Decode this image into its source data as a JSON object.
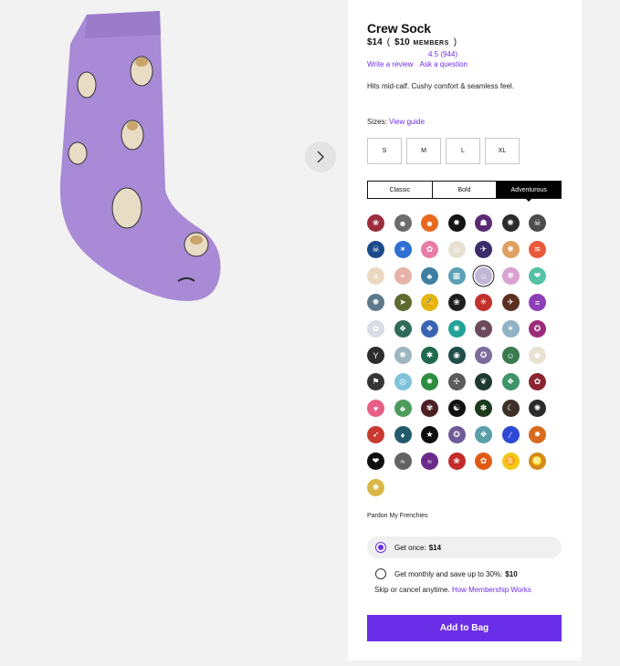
{
  "product": {
    "title": "Crew Sock",
    "price": "$14",
    "paren_open": "(",
    "member_price": "$10",
    "members_label": "MEMBERS",
    "paren_close": ")",
    "rating": "4.5",
    "review_count": "(944)",
    "write_review": "Write a review",
    "ask_question": "Ask a question",
    "description": "Hits mid-calf. Cushy comfort & seamless feel."
  },
  "sizes": {
    "label": "Sizes:",
    "guide_link": "View guide",
    "options": [
      "S",
      "M",
      "L",
      "XL"
    ]
  },
  "style_tabs": [
    "Classic",
    "Bold",
    "Adventurous"
  ],
  "active_style": "Adventurous",
  "swatches": [
    {
      "name": "swatch-1",
      "color": "#9b2d3c",
      "glyph": "❀"
    },
    {
      "name": "swatch-2",
      "color": "#6c6c6c",
      "glyph": "☻"
    },
    {
      "name": "swatch-3",
      "color": "#e8681f",
      "glyph": "☻"
    },
    {
      "name": "swatch-4",
      "color": "#151515",
      "glyph": "✹"
    },
    {
      "name": "swatch-5",
      "color": "#5a2b72",
      "glyph": "☗"
    },
    {
      "name": "swatch-6",
      "color": "#2a2a2a",
      "glyph": "✺"
    },
    {
      "name": "swatch-7",
      "color": "#4c4c4c",
      "glyph": "☠"
    },
    {
      "name": "swatch-8",
      "color": "#1c4a8a",
      "glyph": "☠"
    },
    {
      "name": "swatch-9",
      "color": "#2d6fd2",
      "glyph": "✶"
    },
    {
      "name": "swatch-10",
      "color": "#e87da8",
      "glyph": "✿"
    },
    {
      "name": "swatch-11",
      "color": "#e8e1d3",
      "glyph": "☺"
    },
    {
      "name": "swatch-12",
      "color": "#3a2d6b",
      "glyph": "✈"
    },
    {
      "name": "swatch-13",
      "color": "#e0a05f",
      "glyph": "✺"
    },
    {
      "name": "swatch-14",
      "color": "#e8593b",
      "glyph": "≋"
    },
    {
      "name": "swatch-15",
      "color": "#e9d8c0",
      "glyph": "≡"
    },
    {
      "name": "swatch-16",
      "color": "#e6b3a8",
      "glyph": "◓"
    },
    {
      "name": "swatch-17",
      "color": "#3e7fa3",
      "glyph": "♣"
    },
    {
      "name": "swatch-18",
      "color": "#5ca0b6",
      "glyph": "▦"
    },
    {
      "name": "swatch-19",
      "color": "#bfb7d4",
      "glyph": "☺"
    },
    {
      "name": "swatch-20",
      "color": "#d9a0d0",
      "glyph": "✾"
    },
    {
      "name": "swatch-21",
      "color": "#55c2a6",
      "glyph": "❤"
    },
    {
      "name": "swatch-22",
      "color": "#5d7a8c",
      "glyph": "✺"
    },
    {
      "name": "swatch-23",
      "color": "#5e6b2e",
      "glyph": "➤"
    },
    {
      "name": "swatch-24",
      "color": "#e4b60c",
      "glyph": "✍"
    },
    {
      "name": "swatch-25",
      "color": "#1f1f1f",
      "glyph": "❀"
    },
    {
      "name": "swatch-26",
      "color": "#c0312e",
      "glyph": "✳"
    },
    {
      "name": "swatch-27",
      "color": "#5a2f1f",
      "glyph": "✈"
    },
    {
      "name": "swatch-28",
      "color": "#8c3fb6",
      "glyph": "≡"
    },
    {
      "name": "swatch-29",
      "color": "#d7dce6",
      "glyph": "✿"
    },
    {
      "name": "swatch-30",
      "color": "#2f6b58",
      "glyph": "❖"
    },
    {
      "name": "swatch-31",
      "color": "#3a64b3",
      "glyph": "❖"
    },
    {
      "name": "swatch-32",
      "color": "#22a39a",
      "glyph": "✺"
    },
    {
      "name": "swatch-33",
      "color": "#6b4a5a",
      "glyph": "⚭"
    },
    {
      "name": "swatch-34",
      "color": "#8fb3c4",
      "glyph": "✶"
    },
    {
      "name": "swatch-35",
      "color": "#9c2c7a",
      "glyph": "✪"
    },
    {
      "name": "swatch-36",
      "color": "#2d2d2d",
      "glyph": "Y"
    },
    {
      "name": "swatch-37",
      "color": "#9db6c0",
      "glyph": "✺"
    },
    {
      "name": "swatch-38",
      "color": "#1f6a4d",
      "glyph": "✱"
    },
    {
      "name": "swatch-39",
      "color": "#1f4d4a",
      "glyph": "◉"
    },
    {
      "name": "swatch-40",
      "color": "#7c6b9c",
      "glyph": "✪"
    },
    {
      "name": "swatch-41",
      "color": "#3a7a4e",
      "glyph": "☺"
    },
    {
      "name": "swatch-42",
      "color": "#e9e2d3",
      "glyph": "◆"
    },
    {
      "name": "swatch-43",
      "color": "#353535",
      "glyph": "⚑"
    },
    {
      "name": "swatch-44",
      "color": "#7fc3da",
      "glyph": "◎"
    },
    {
      "name": "swatch-45",
      "color": "#2e8b3f",
      "glyph": "✸"
    },
    {
      "name": "swatch-46",
      "color": "#5a5a5a",
      "glyph": "✢"
    },
    {
      "name": "swatch-47",
      "color": "#1e3a30",
      "glyph": "❦"
    },
    {
      "name": "swatch-48",
      "color": "#3e9466",
      "glyph": "❖"
    },
    {
      "name": "swatch-49",
      "color": "#8a2530",
      "glyph": "✿"
    },
    {
      "name": "swatch-50",
      "color": "#e85f86",
      "glyph": "♥"
    },
    {
      "name": "swatch-51",
      "color": "#4e9c5e",
      "glyph": "♣"
    },
    {
      "name": "swatch-52",
      "color": "#4a1f24",
      "glyph": "✾"
    },
    {
      "name": "swatch-53",
      "color": "#111111",
      "glyph": "☯"
    },
    {
      "name": "swatch-54",
      "color": "#1b3a1b",
      "glyph": "✽"
    },
    {
      "name": "swatch-55",
      "color": "#3d3029",
      "glyph": "☾"
    },
    {
      "name": "swatch-56",
      "color": "#2b2b2b",
      "glyph": "✺"
    },
    {
      "name": "swatch-57",
      "color": "#c83a30",
      "glyph": "➶"
    },
    {
      "name": "swatch-58",
      "color": "#225a6b",
      "glyph": "♦"
    },
    {
      "name": "swatch-59",
      "color": "#0d0d0d",
      "glyph": "★"
    },
    {
      "name": "swatch-60",
      "color": "#6e5a96",
      "glyph": "✪"
    },
    {
      "name": "swatch-61",
      "color": "#5a9faa",
      "glyph": "❖"
    },
    {
      "name": "swatch-62",
      "color": "#2e48d6",
      "glyph": "⁄"
    },
    {
      "name": "swatch-63",
      "color": "#d86a1f",
      "glyph": "✸"
    },
    {
      "name": "swatch-64",
      "color": "#0f0f0f",
      "glyph": "❤"
    },
    {
      "name": "swatch-65",
      "color": "#636363",
      "glyph": "≈"
    },
    {
      "name": "swatch-66",
      "color": "#6b2a8a",
      "glyph": "≈"
    },
    {
      "name": "swatch-67",
      "color": "#c32a2a",
      "glyph": "❀"
    },
    {
      "name": "swatch-68",
      "color": "#e25b16",
      "glyph": "✿"
    },
    {
      "name": "swatch-69",
      "color": "#f2c715",
      "glyph": "♊"
    },
    {
      "name": "swatch-70",
      "color": "#d68a18",
      "glyph": "♌"
    },
    {
      "name": "swatch-71",
      "color": "#d8b845",
      "glyph": "✺"
    }
  ],
  "design_name": "Pardon My Frenchies",
  "purchase": {
    "once_label": "Get once:",
    "once_price": "$14",
    "monthly_label": "Get monthly and save up to 30%:",
    "monthly_price": "$10",
    "skip_text": "Skip or cancel anytime.",
    "membership_link": "How Membership Works",
    "add_button": "Add to Bag"
  },
  "colors": {
    "accent": "#6b2ee8",
    "sock_body": "#a88ad6"
  },
  "icons": {
    "next": "chevron-right-icon"
  }
}
